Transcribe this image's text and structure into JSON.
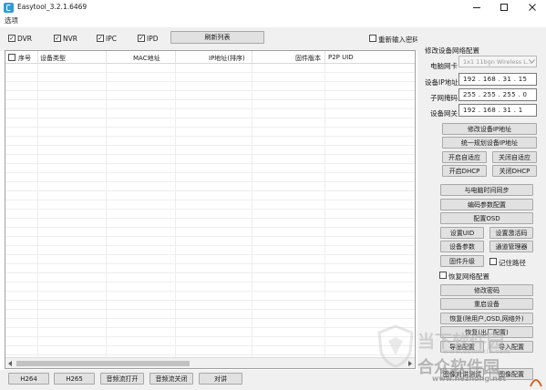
{
  "window": {
    "title": "Easytool_3.2.1.6469",
    "minimize_icon": "minimize-icon",
    "maximize_icon": "maximize-icon",
    "close_icon": "close-icon"
  },
  "menu": {
    "options": "选项"
  },
  "filters": {
    "dvr": "DVR",
    "nvr": "NVR",
    "ipc": "IPC",
    "ipd": "IPD",
    "refresh_button": "刷新列表",
    "reenter_password": "重新输入密码"
  },
  "table": {
    "columns": [
      "序号",
      "设备类型",
      "MAC地址",
      "IP地址(排序)",
      "固件版本",
      "P2P UID"
    ],
    "rows": []
  },
  "network": {
    "section_title": "修改设备网络配置",
    "nic_label": "电脑网卡",
    "nic_value": "1x1 11bgn Wireless L...",
    "ip_label": "设备IP地址",
    "ip_value": "192 . 168 . 31 . 15",
    "mask_label": "子网掩码",
    "mask_value": "255 . 255 . 255 . 0",
    "gateway_label": "设备网关",
    "gateway_value": "192 . 168 . 31 . 1",
    "modify_ip": "修改设备IP地址",
    "plan_ip": "统一规划设备IP地址",
    "enable_adaptive": "开启自适应",
    "disable_adaptive": "关闭自适应",
    "enable_dhcp": "开启DHCP",
    "disable_dhcp": "关闭DHCP"
  },
  "actions": {
    "sync_time": "与电脑时间同步",
    "encode_params": "编码参数配置",
    "config_osd": "配置OSD",
    "set_uid": "设置UID",
    "set_activation": "设置激活码",
    "device_params": "设备参数",
    "channel_manager": "通道管理器",
    "firmware_upgrade": "固件升级",
    "remember_path": "记住路径",
    "restore_network": "恢复网络配置",
    "change_password": "修改密码",
    "reboot": "重启设备",
    "restore_except": "恢复(除用户,OSD,网络外)",
    "restore_factory": "恢复(出厂配置)",
    "export_config": "导出配置",
    "import_config": "导入配置",
    "image_test": "图像对讲测试",
    "image_config": "图像配置"
  },
  "bottom": {
    "h264": "H264",
    "h265": "H265",
    "audio_on": "音频流打开",
    "audio_off": "音频流关闭",
    "talk": "对讲"
  },
  "watermark": {
    "site": "当下软件园",
    "domain": "www.downxia.com",
    "site2": "合众软件园",
    "domain2": "www.hezhong.net"
  }
}
